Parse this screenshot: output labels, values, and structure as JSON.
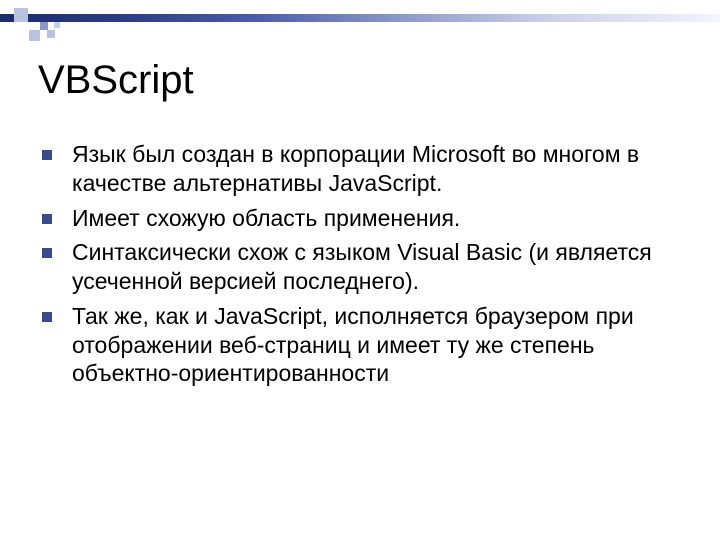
{
  "title": "VBScript",
  "bullets": [
    "Язык был создан в корпорации Microsoft во многом в качестве альтернативы JavaScript.",
    "Имеет схожую область применения.",
    "Синтаксически схож с языком Visual Basic (и является усеченной версией последнего).",
    "Так же, как и JavaScript, исполняется браузером при отображении веб-страниц и имеет ту же степень объектно-ориентированности"
  ]
}
